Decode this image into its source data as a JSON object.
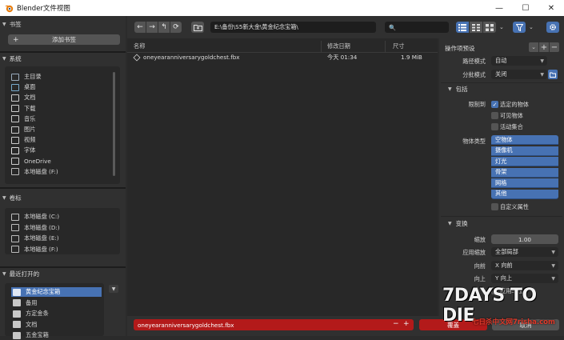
{
  "window": {
    "title": "Blender文件视图",
    "controls": {
      "minimize": "—",
      "maximize": "☐",
      "close": "✕"
    }
  },
  "sidebar": {
    "bookmarks": {
      "title": "书签",
      "add_label": "添加书签"
    },
    "system": {
      "title": "系统",
      "items": [
        {
          "label": "主目录",
          "icon": "home-folder-icon"
        },
        {
          "label": "桌面",
          "icon": "desktop-icon"
        },
        {
          "label": "文档",
          "icon": "documents-icon"
        },
        {
          "label": "下载",
          "icon": "download-icon"
        },
        {
          "label": "音乐",
          "icon": "music-icon"
        },
        {
          "label": "图片",
          "icon": "pictures-icon"
        },
        {
          "label": "视频",
          "icon": "video-icon"
        },
        {
          "label": "字体",
          "icon": "font-icon"
        },
        {
          "label": "OneDrive",
          "icon": "cloud-icon"
        },
        {
          "label": "本地磁盘 (F:)",
          "icon": "disk-icon"
        }
      ]
    },
    "volumes": {
      "title": "卷标",
      "items": [
        {
          "label": "本地磁盘 (C:)"
        },
        {
          "label": "本地磁盘 (D:)"
        },
        {
          "label": "本地磁盘 (E:)"
        },
        {
          "label": "本地磁盘 (F:)"
        }
      ]
    },
    "recent": {
      "title": "最近打开的",
      "items": [
        {
          "label": "黄金纪念宝箱",
          "selected": true
        },
        {
          "label": "备用"
        },
        {
          "label": "方定金条"
        },
        {
          "label": "文档"
        },
        {
          "label": "五金宝箱"
        }
      ]
    }
  },
  "toolbar": {
    "back": "←",
    "forward": "→",
    "parent": "↰",
    "refresh": "⟳",
    "new_folder": "+",
    "path": "E:\\备份\\S5新大金\\黄金纪念宝箱\\",
    "search_placeholder": "🔍"
  },
  "filelist": {
    "headers": {
      "name": "名称",
      "date": "修改日期",
      "size": "尺寸"
    },
    "rows": [
      {
        "name": "oneyearanniversarygoldchest.fbx",
        "date": "今天 01:34",
        "size": "1.9 MiB"
      }
    ]
  },
  "right_panel": {
    "preset_label": "操作项预设",
    "path_mode": {
      "label": "路径模式",
      "value": "自动"
    },
    "batch_mode": {
      "label": "分批模式",
      "value": "关闭"
    },
    "include": {
      "title": "包括",
      "limit_label": "限制到",
      "selected_objects": "选定的物体",
      "visible_objects": "可见物体",
      "active_collection": "活动集合",
      "object_types_label": "物体类型",
      "object_types": [
        "空物体",
        "摄像机",
        "灯光",
        "骨架",
        "网格",
        "其他"
      ],
      "custom_props": "自定义属性"
    },
    "transform": {
      "title": "变换",
      "scale": {
        "label": "缩放",
        "value": "1.00"
      },
      "apply_scalings": {
        "label": "应用缩放",
        "value": "全部局部"
      },
      "forward": {
        "label": "向前",
        "value": "X 向前"
      },
      "up": {
        "label": "向上",
        "value": "Y 向上"
      },
      "apply_unit": "应用单位"
    }
  },
  "bottombar": {
    "filename": "oneyearanniversarygoldchest.fbx",
    "minus": "−",
    "plus": "+",
    "confirm": "覆盖",
    "cancel": "取消"
  },
  "watermark": {
    "line1": "7DAYS TO DIE",
    "line2": "七日杀中文网7risha.com"
  },
  "colors": {
    "accent": "#4772b3",
    "panel": "#303030",
    "area": "#282828",
    "error_red": "#b31a1a"
  }
}
